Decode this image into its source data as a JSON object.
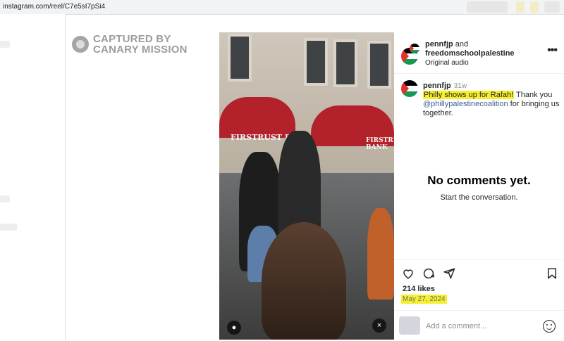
{
  "browser": {
    "url": "instagram.com/reel/C7e5sI7pSi4"
  },
  "watermark": {
    "line1": "CAPTURED BY",
    "line2": "CANARY MISSION"
  },
  "video": {
    "sign_left": "FIRSTRUST BANK",
    "sign_right": "FIRSTRUST BANK"
  },
  "post": {
    "header": {
      "user1": "pennfjp",
      "and": "and",
      "user2": "freedomschoolpalestine",
      "audio": "Original audio"
    },
    "caption": {
      "user": "pennfjp",
      "time": "31w",
      "highlight": "Philly shows up for Rafah!",
      "text1": " Thank you ",
      "mention": "@phillypalestinecoalition",
      "text2": " for bringing us together."
    },
    "no_comments_title": "No comments yet.",
    "no_comments_sub": "Start the conversation.",
    "likes": "214 likes",
    "date": "May 27, 2024",
    "comment_placeholder": "Add a comment...",
    "more_glyph": "•••"
  },
  "icons": [
    "heart-icon",
    "comment-icon",
    "share-icon",
    "bookmark-icon",
    "emoji-icon",
    "mute-icon",
    "user-tag-icon",
    "more-icon"
  ],
  "colors": {
    "highlight": "#f6ef2d",
    "mention": "#3c5f92",
    "awning": "#b3212a",
    "flag_black": "#000000",
    "flag_white": "#ffffff",
    "flag_green": "#149954",
    "flag_red": "#e4312b"
  }
}
